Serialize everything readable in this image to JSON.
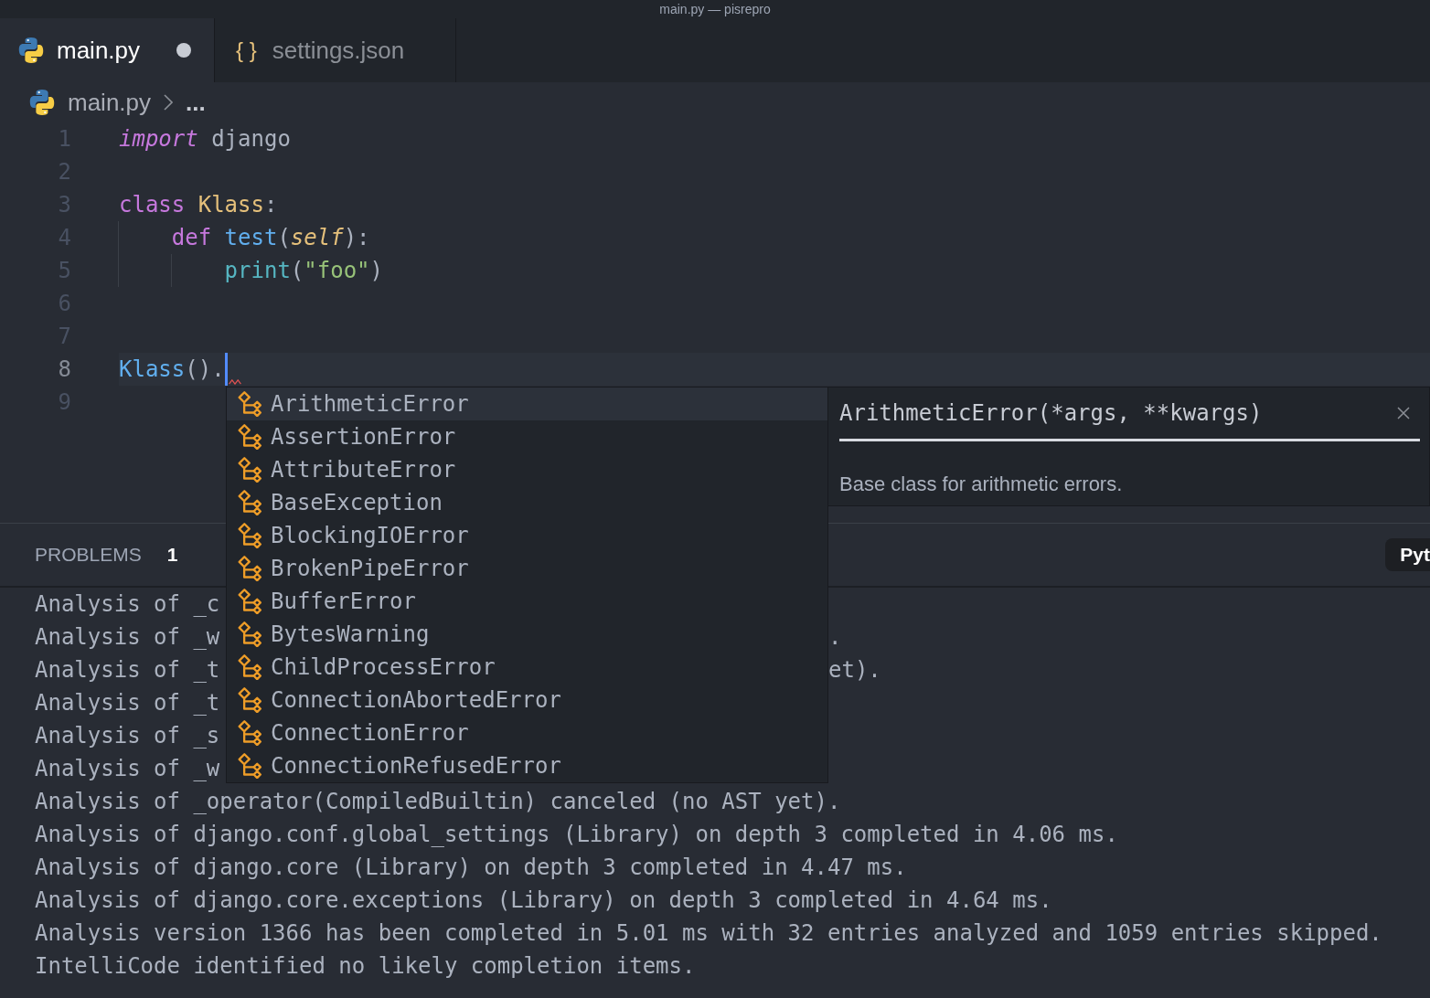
{
  "window": {
    "title": "main.py — pisrepro"
  },
  "tabs": [
    {
      "label": "main.py",
      "kind": "python",
      "selected": true,
      "modified": true
    },
    {
      "label": "settings.json",
      "kind": "json",
      "icon": "{ }",
      "selected": false,
      "modified": false
    }
  ],
  "breadcrumb": {
    "items": [
      {
        "label": "main.py",
        "kind": "python"
      },
      {
        "label": "...",
        "kind": "more"
      }
    ]
  },
  "editor": {
    "lines": [
      {
        "number": "1",
        "current": false,
        "error": false,
        "tokens": [
          {
            "text": "import",
            "kind": "import-keyword"
          },
          {
            "text": " django",
            "kind": "plain"
          }
        ]
      },
      {
        "number": "2",
        "current": false,
        "error": false
      },
      {
        "number": "3",
        "current": false,
        "error": false,
        "tokens": [
          {
            "text": "class",
            "kind": "keyword"
          },
          {
            "text": " Klass",
            "kind": "class-name"
          },
          {
            "text": ":",
            "kind": "plain"
          }
        ]
      },
      {
        "number": "4",
        "current": false,
        "error": false,
        "tokens": [
          {
            "text": "    def",
            "kind": "keyword"
          },
          {
            "text": " test",
            "kind": "function"
          },
          {
            "text": "(",
            "kind": "plain"
          },
          {
            "text": "self",
            "kind": "param"
          },
          {
            "text": "):",
            "kind": "plain"
          }
        ]
      },
      {
        "number": "5",
        "current": false,
        "error": false,
        "tokens": [
          {
            "text": "        print",
            "kind": "builtin"
          },
          {
            "text": "(",
            "kind": "plain"
          },
          {
            "text": "\"foo\"",
            "kind": "string"
          },
          {
            "text": ")",
            "kind": "plain"
          }
        ]
      },
      {
        "number": "6",
        "current": false,
        "error": false
      },
      {
        "number": "7",
        "current": false,
        "error": false
      },
      {
        "number": "8",
        "current": true,
        "error": true,
        "tokens": [
          {
            "text": "Klass",
            "kind": "call"
          },
          {
            "text": "().",
            "kind": "plain"
          }
        ]
      },
      {
        "number": "9",
        "current": false,
        "error": false
      }
    ]
  },
  "suggestions": {
    "items": [
      {
        "label": "ArithmeticError",
        "selected": true
      },
      {
        "label": "AssertionError",
        "selected": false
      },
      {
        "label": "AttributeError",
        "selected": false
      },
      {
        "label": "BaseException",
        "selected": false
      },
      {
        "label": "BlockingIOError",
        "selected": false
      },
      {
        "label": "BrokenPipeError",
        "selected": false
      },
      {
        "label": "BufferError",
        "selected": false
      },
      {
        "label": "BytesWarning",
        "selected": false
      },
      {
        "label": "ChildProcessError",
        "selected": false
      },
      {
        "label": "ConnectionAbortedError",
        "selected": false
      },
      {
        "label": "ConnectionError",
        "selected": false
      },
      {
        "label": "ConnectionRefusedError",
        "selected": false
      }
    ],
    "details": {
      "signature": "ArithmeticError(*args, **kwargs)",
      "description": "Base class for arithmetic errors."
    }
  },
  "panel": {
    "tabs": [
      {
        "label": "PROBLEMS",
        "count": "1",
        "selected": false
      }
    ],
    "channel": "Pyt",
    "output_lines": [
      {
        "segments": [
          "Analysis of _c"
        ]
      },
      {
        "segments": [
          "Analysis of _w",
          "."
        ]
      },
      {
        "segments": [
          "Analysis of _t",
          "et)."
        ]
      },
      {
        "segments": [
          "Analysis of _t"
        ]
      },
      {
        "segments": [
          "Analysis of _s"
        ]
      },
      {
        "segments": [
          "Analysis of _w"
        ]
      },
      {
        "segments": [
          "Analysis of _operator(CompiledBuiltin) canceled (no AST yet)."
        ]
      },
      {
        "segments": [
          "Analysis of django.conf.global_settings (Library) on depth 3 completed in 4.06 ms."
        ]
      },
      {
        "segments": [
          "Analysis of django.core (Library) on depth 3 completed in 4.47 ms."
        ]
      },
      {
        "segments": [
          "Analysis of django.core.exceptions (Library) on depth 3 completed in 4.64 ms."
        ]
      },
      {
        "segments": [
          "Analysis version 1366 has been completed in 5.01 ms with 32 entries analyzed and 1059 entries skipped."
        ]
      },
      {
        "segments": [
          "IntelliCode identified no likely completion items."
        ]
      }
    ]
  }
}
